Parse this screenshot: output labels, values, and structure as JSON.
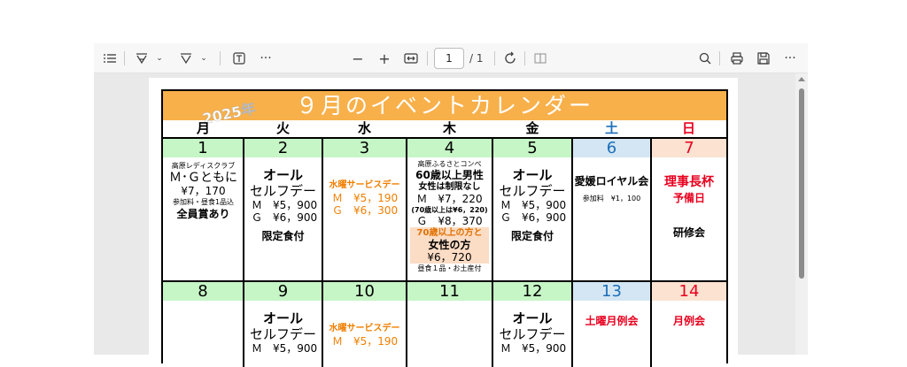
{
  "toolbar": {
    "page_number": "1",
    "page_total": "/ 1"
  },
  "calendar": {
    "year": "2025年",
    "title": "９月のイベントカレンダー",
    "weekdays": [
      "月",
      "火",
      "水",
      "木",
      "金",
      "土",
      "日"
    ],
    "colors": {
      "header": "#f8b04a",
      "weekday_date_bg": "#c6f5c6",
      "saturday_bg": "#d4e6f3",
      "sunday_bg": "#fbe2d1",
      "saturday_text": "#1c6fba",
      "sunday_text": "#e8001e",
      "orange_text": "#f07e00"
    },
    "week1": {
      "dates": [
        "1",
        "2",
        "3",
        "4",
        "5",
        "6",
        "7"
      ],
      "mon": {
        "l1": "高原レディスクラブ",
        "l2": "Ｍ･Ｇともに",
        "l3": "¥7，170",
        "l4": "参加料・昼食1品込",
        "l5": "全員賞あり"
      },
      "tue": {
        "l1": "オール",
        "l2": "セルフデー",
        "l3": "Ｍ　¥5，900",
        "l4": "Ｇ　¥6，900",
        "l5": "限定食付"
      },
      "wed": {
        "l1": "水曜サービスデー",
        "l2": "Ｍ　¥5，190",
        "l3": "Ｇ　¥6，300"
      },
      "thu": {
        "l1": "高原ふるさとコンペ",
        "l2": "60歳以上男性",
        "l3": "女性は制限なし",
        "l4": "Ｍ　¥7，220",
        "l5": "(70歳以上は¥6，220)",
        "l6": "Ｇ　¥8，370",
        "l7": "70歳以上の方と",
        "l8": "女性の方",
        "l9": "¥6，720",
        "l10": "昼食１品・お土産付"
      },
      "fri": {
        "l1": "オール",
        "l2": "セルフデー",
        "l3": "Ｍ　¥5，900",
        "l4": "Ｇ　¥6，900",
        "l5": "限定食付"
      },
      "sat": {
        "l1": "愛媛ロイヤル会",
        "l2": "参加料　¥1，100"
      },
      "sun": {
        "l1": "理事長杯",
        "l2": "予備日",
        "l3": "研修会"
      }
    },
    "week2": {
      "dates": [
        "8",
        "9",
        "10",
        "11",
        "12",
        "13",
        "14"
      ],
      "tue": {
        "l1": "オール",
        "l2": "セルフデー",
        "l3": "Ｍ　¥5，900"
      },
      "wed": {
        "l1": "水曜サービスデー",
        "l2": "Ｍ　¥5，190"
      },
      "fri": {
        "l1": "オール",
        "l2": "セルフデー",
        "l3": "Ｍ　¥5，900"
      },
      "sat": {
        "l1": "土曜月例会"
      },
      "sun": {
        "l1": "月例会"
      }
    }
  }
}
